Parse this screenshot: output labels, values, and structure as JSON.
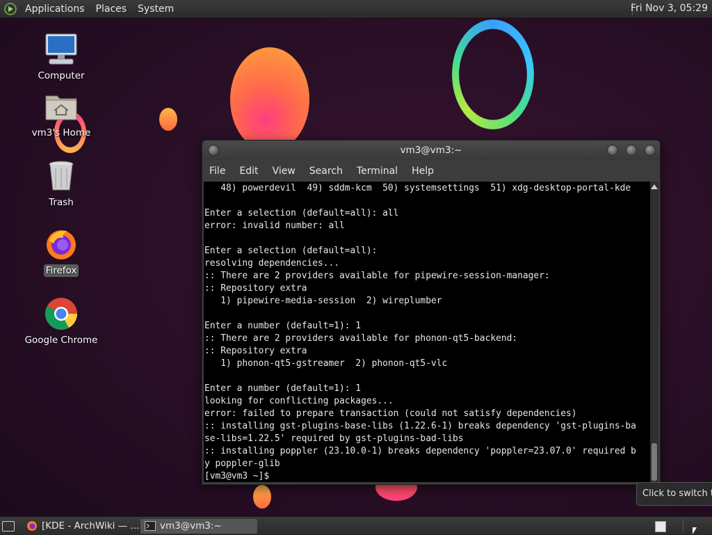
{
  "top_panel": {
    "menus": [
      "Applications",
      "Places",
      "System"
    ],
    "clock": "Fri Nov 3, 05:29"
  },
  "desktop": {
    "icons": [
      {
        "label": "Computer",
        "icon": "computer-icon"
      },
      {
        "label": "vm3's Home",
        "icon": "home-folder-icon"
      },
      {
        "label": "Trash",
        "icon": "trash-icon"
      },
      {
        "label": "Firefox",
        "icon": "firefox-icon"
      },
      {
        "label": "Google Chrome",
        "icon": "chrome-icon"
      }
    ]
  },
  "terminal": {
    "title": "vm3@vm3:~",
    "menu": [
      "File",
      "Edit",
      "View",
      "Search",
      "Terminal",
      "Help"
    ],
    "lines": [
      "   48) powerdevil  49) sddm-kcm  50) systemsettings  51) xdg-desktop-portal-kde",
      "",
      "Enter a selection (default=all): all",
      "error: invalid number: all",
      "",
      "Enter a selection (default=all):",
      "resolving dependencies...",
      ":: There are 2 providers available for pipewire-session-manager:",
      ":: Repository extra",
      "   1) pipewire-media-session  2) wireplumber",
      "",
      "Enter a number (default=1): 1",
      ":: There are 2 providers available for phonon-qt5-backend:",
      ":: Repository extra",
      "   1) phonon-qt5-gstreamer  2) phonon-qt5-vlc",
      "",
      "Enter a number (default=1): 1",
      "looking for conflicting packages...",
      "error: failed to prepare transaction (could not satisfy dependencies)",
      ":: installing gst-plugins-base-libs (1.22.6-1) breaks dependency 'gst-plugins-ba",
      "se-libs=1.22.5' required by gst-plugins-bad-libs",
      ":: installing poppler (23.10.0-1) breaks dependency 'poppler=23.07.0' required b",
      "y poppler-glib",
      "[vm3@vm3 ~]$ "
    ]
  },
  "tooltip": "Click to switch to",
  "taskbar": {
    "tasks": [
      {
        "label": "[KDE - ArchWiki — ...",
        "icon": "firefox-icon"
      },
      {
        "label": "vm3@vm3:~",
        "icon": "terminal-icon"
      }
    ]
  },
  "colors": {
    "desktop_bg": "#2a0f27",
    "panel_bg": "#2f2f2f",
    "terminal_bg": "#000000",
    "terminal_fg": "#e8e8e8"
  }
}
